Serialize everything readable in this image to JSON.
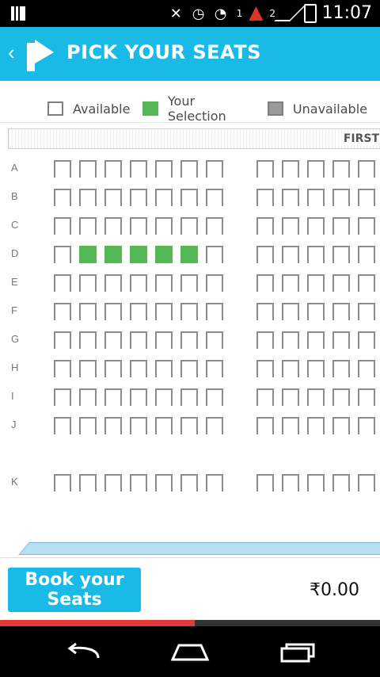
{
  "status": {
    "time": "11:07",
    "sim1": "1",
    "sim2": "2"
  },
  "appbar": {
    "title": "PICK YOUR SEATS"
  },
  "legend": {
    "available": "Available",
    "selection": "Your Selection",
    "unavailable": "Unavailable"
  },
  "screen": {
    "label": "FIRST"
  },
  "rows": [
    {
      "label": "A",
      "seats": [
        0,
        0,
        0,
        0,
        0,
        0,
        0,
        0,
        0,
        0,
        0,
        0
      ]
    },
    {
      "label": "B",
      "seats": [
        0,
        0,
        0,
        0,
        0,
        0,
        0,
        0,
        0,
        0,
        0,
        0
      ]
    },
    {
      "label": "C",
      "seats": [
        0,
        0,
        0,
        0,
        0,
        0,
        0,
        0,
        0,
        0,
        0,
        0
      ]
    },
    {
      "label": "D",
      "seats": [
        0,
        1,
        1,
        1,
        1,
        1,
        0,
        0,
        0,
        0,
        0,
        0
      ]
    },
    {
      "label": "E",
      "seats": [
        0,
        0,
        0,
        0,
        0,
        0,
        0,
        0,
        0,
        0,
        0,
        0
      ]
    },
    {
      "label": "F",
      "seats": [
        0,
        0,
        0,
        0,
        0,
        0,
        0,
        0,
        0,
        0,
        0,
        0
      ]
    },
    {
      "label": "G",
      "seats": [
        0,
        0,
        0,
        0,
        0,
        0,
        0,
        0,
        0,
        0,
        0,
        0
      ]
    },
    {
      "label": "H",
      "seats": [
        0,
        0,
        0,
        0,
        0,
        0,
        0,
        0,
        0,
        0,
        0,
        0
      ]
    },
    {
      "label": "I",
      "seats": [
        0,
        0,
        0,
        0,
        0,
        0,
        0,
        0,
        0,
        0,
        0,
        0
      ]
    },
    {
      "label": "J",
      "seats": [
        0,
        0,
        0,
        0,
        0,
        0,
        0,
        0,
        0,
        0,
        0,
        0
      ]
    },
    {
      "label": "",
      "seats": []
    },
    {
      "label": "K",
      "seats": [
        0,
        0,
        0,
        0,
        0,
        0,
        0,
        0,
        0,
        0,
        0,
        0
      ]
    }
  ],
  "footer": {
    "book_label": "Book your Seats",
    "price": "₹0.00"
  },
  "colors": {
    "accent": "#19bbe6",
    "selected": "#54b954",
    "unavailable": "#9a9a9a",
    "progress": "#e53935"
  }
}
